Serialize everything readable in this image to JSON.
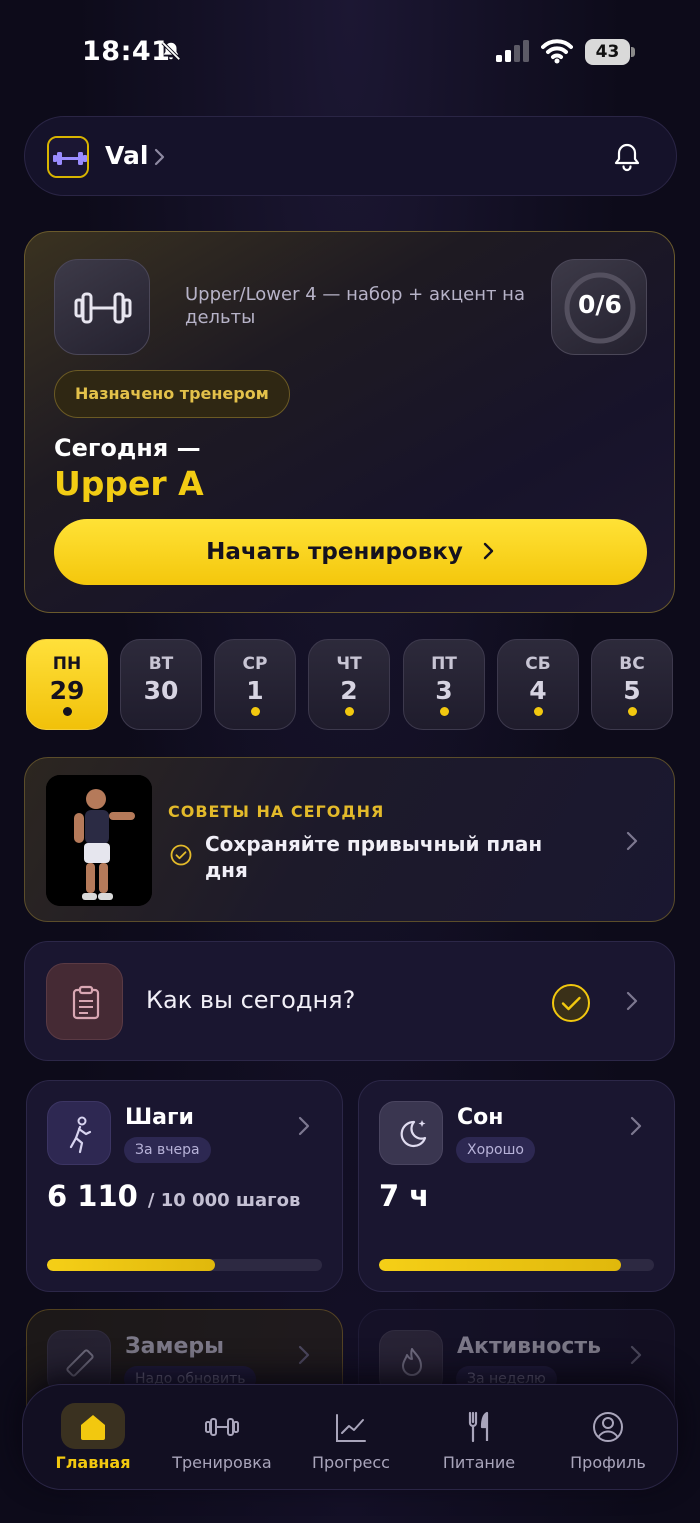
{
  "status_bar": {
    "time": "18:41",
    "battery": "43"
  },
  "header": {
    "user_name": "Val"
  },
  "workout": {
    "plan_name": "Upper/Lower 4 — набор + акцент на дельты",
    "progress": "0/6",
    "assigned_badge": "Назначено тренером",
    "today_label": "Сегодня —",
    "today_workout": "Upper A",
    "start_button": "Начать тренировку"
  },
  "week": [
    {
      "day": "ПН",
      "date": "29",
      "active": true,
      "dot": true
    },
    {
      "day": "ВТ",
      "date": "30",
      "active": false,
      "dot": false
    },
    {
      "day": "СР",
      "date": "1",
      "active": false,
      "dot": true
    },
    {
      "day": "ЧТ",
      "date": "2",
      "active": false,
      "dot": true
    },
    {
      "day": "ПТ",
      "date": "3",
      "active": false,
      "dot": true
    },
    {
      "day": "СБ",
      "date": "4",
      "active": false,
      "dot": true
    },
    {
      "day": "ВС",
      "date": "5",
      "active": false,
      "dot": true
    }
  ],
  "tips": {
    "title": "СОВЕТЫ НА СЕГОДНЯ",
    "text": "Сохраняйте привычный план дня"
  },
  "mood": {
    "question": "Как вы сегодня?"
  },
  "stats": {
    "steps": {
      "title": "Шаги",
      "badge": "За вчера",
      "value": "6 110",
      "goal": "/ 10 000 шагов",
      "progress": 0.611
    },
    "sleep": {
      "title": "Сон",
      "badge": "Хорошо",
      "value": "7 ч",
      "progress": 0.88
    },
    "measurements": {
      "title": "Замеры",
      "badge": "Надо обновить"
    },
    "activity": {
      "title": "Активность",
      "badge": "За неделю"
    }
  },
  "nav": [
    {
      "label": "Главная",
      "icon": "home-icon",
      "active": true
    },
    {
      "label": "Тренировка",
      "icon": "dumbbell-icon",
      "active": false
    },
    {
      "label": "Прогресс",
      "icon": "chart-icon",
      "active": false
    },
    {
      "label": "Питание",
      "icon": "fork-knife-icon",
      "active": false
    },
    {
      "label": "Профиль",
      "icon": "profile-icon",
      "active": false
    }
  ],
  "colors": {
    "accent": "#f2c80f",
    "background": "#0d0b1a",
    "card": "#1a1630"
  }
}
